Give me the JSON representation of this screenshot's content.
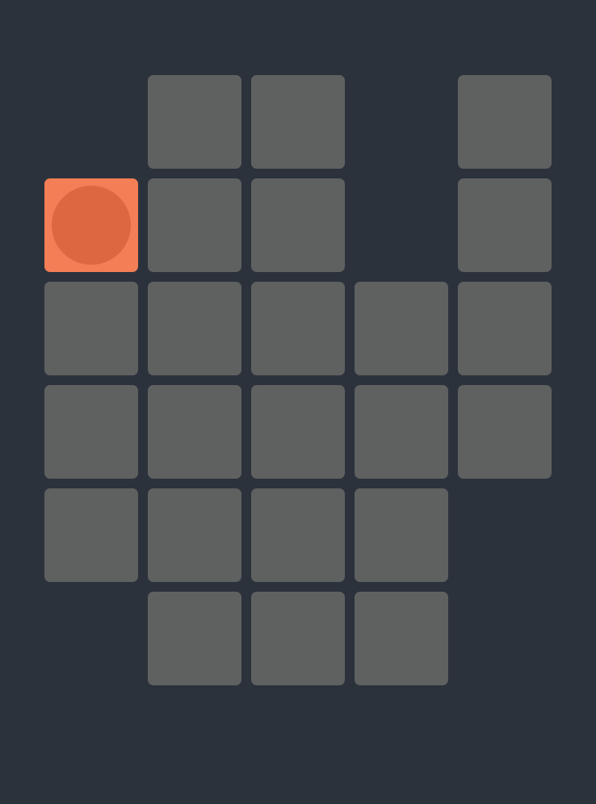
{
  "game": {
    "rows": 6,
    "cols": 5,
    "colors": {
      "background": "#2c323c",
      "tile": "#5f6160",
      "active_tile": "#f47e55",
      "player_token": "#dd6740"
    },
    "grid": [
      [
        0,
        1,
        1,
        0,
        1
      ],
      [
        2,
        1,
        1,
        0,
        1
      ],
      [
        1,
        1,
        1,
        1,
        1
      ],
      [
        1,
        1,
        1,
        1,
        1
      ],
      [
        1,
        1,
        1,
        1,
        0
      ],
      [
        0,
        1,
        1,
        1,
        0
      ]
    ],
    "legend": {
      "0": "empty",
      "1": "tile",
      "2": "active-tile-with-player"
    },
    "player": {
      "row": 1,
      "col": 0,
      "token": "circle"
    }
  }
}
